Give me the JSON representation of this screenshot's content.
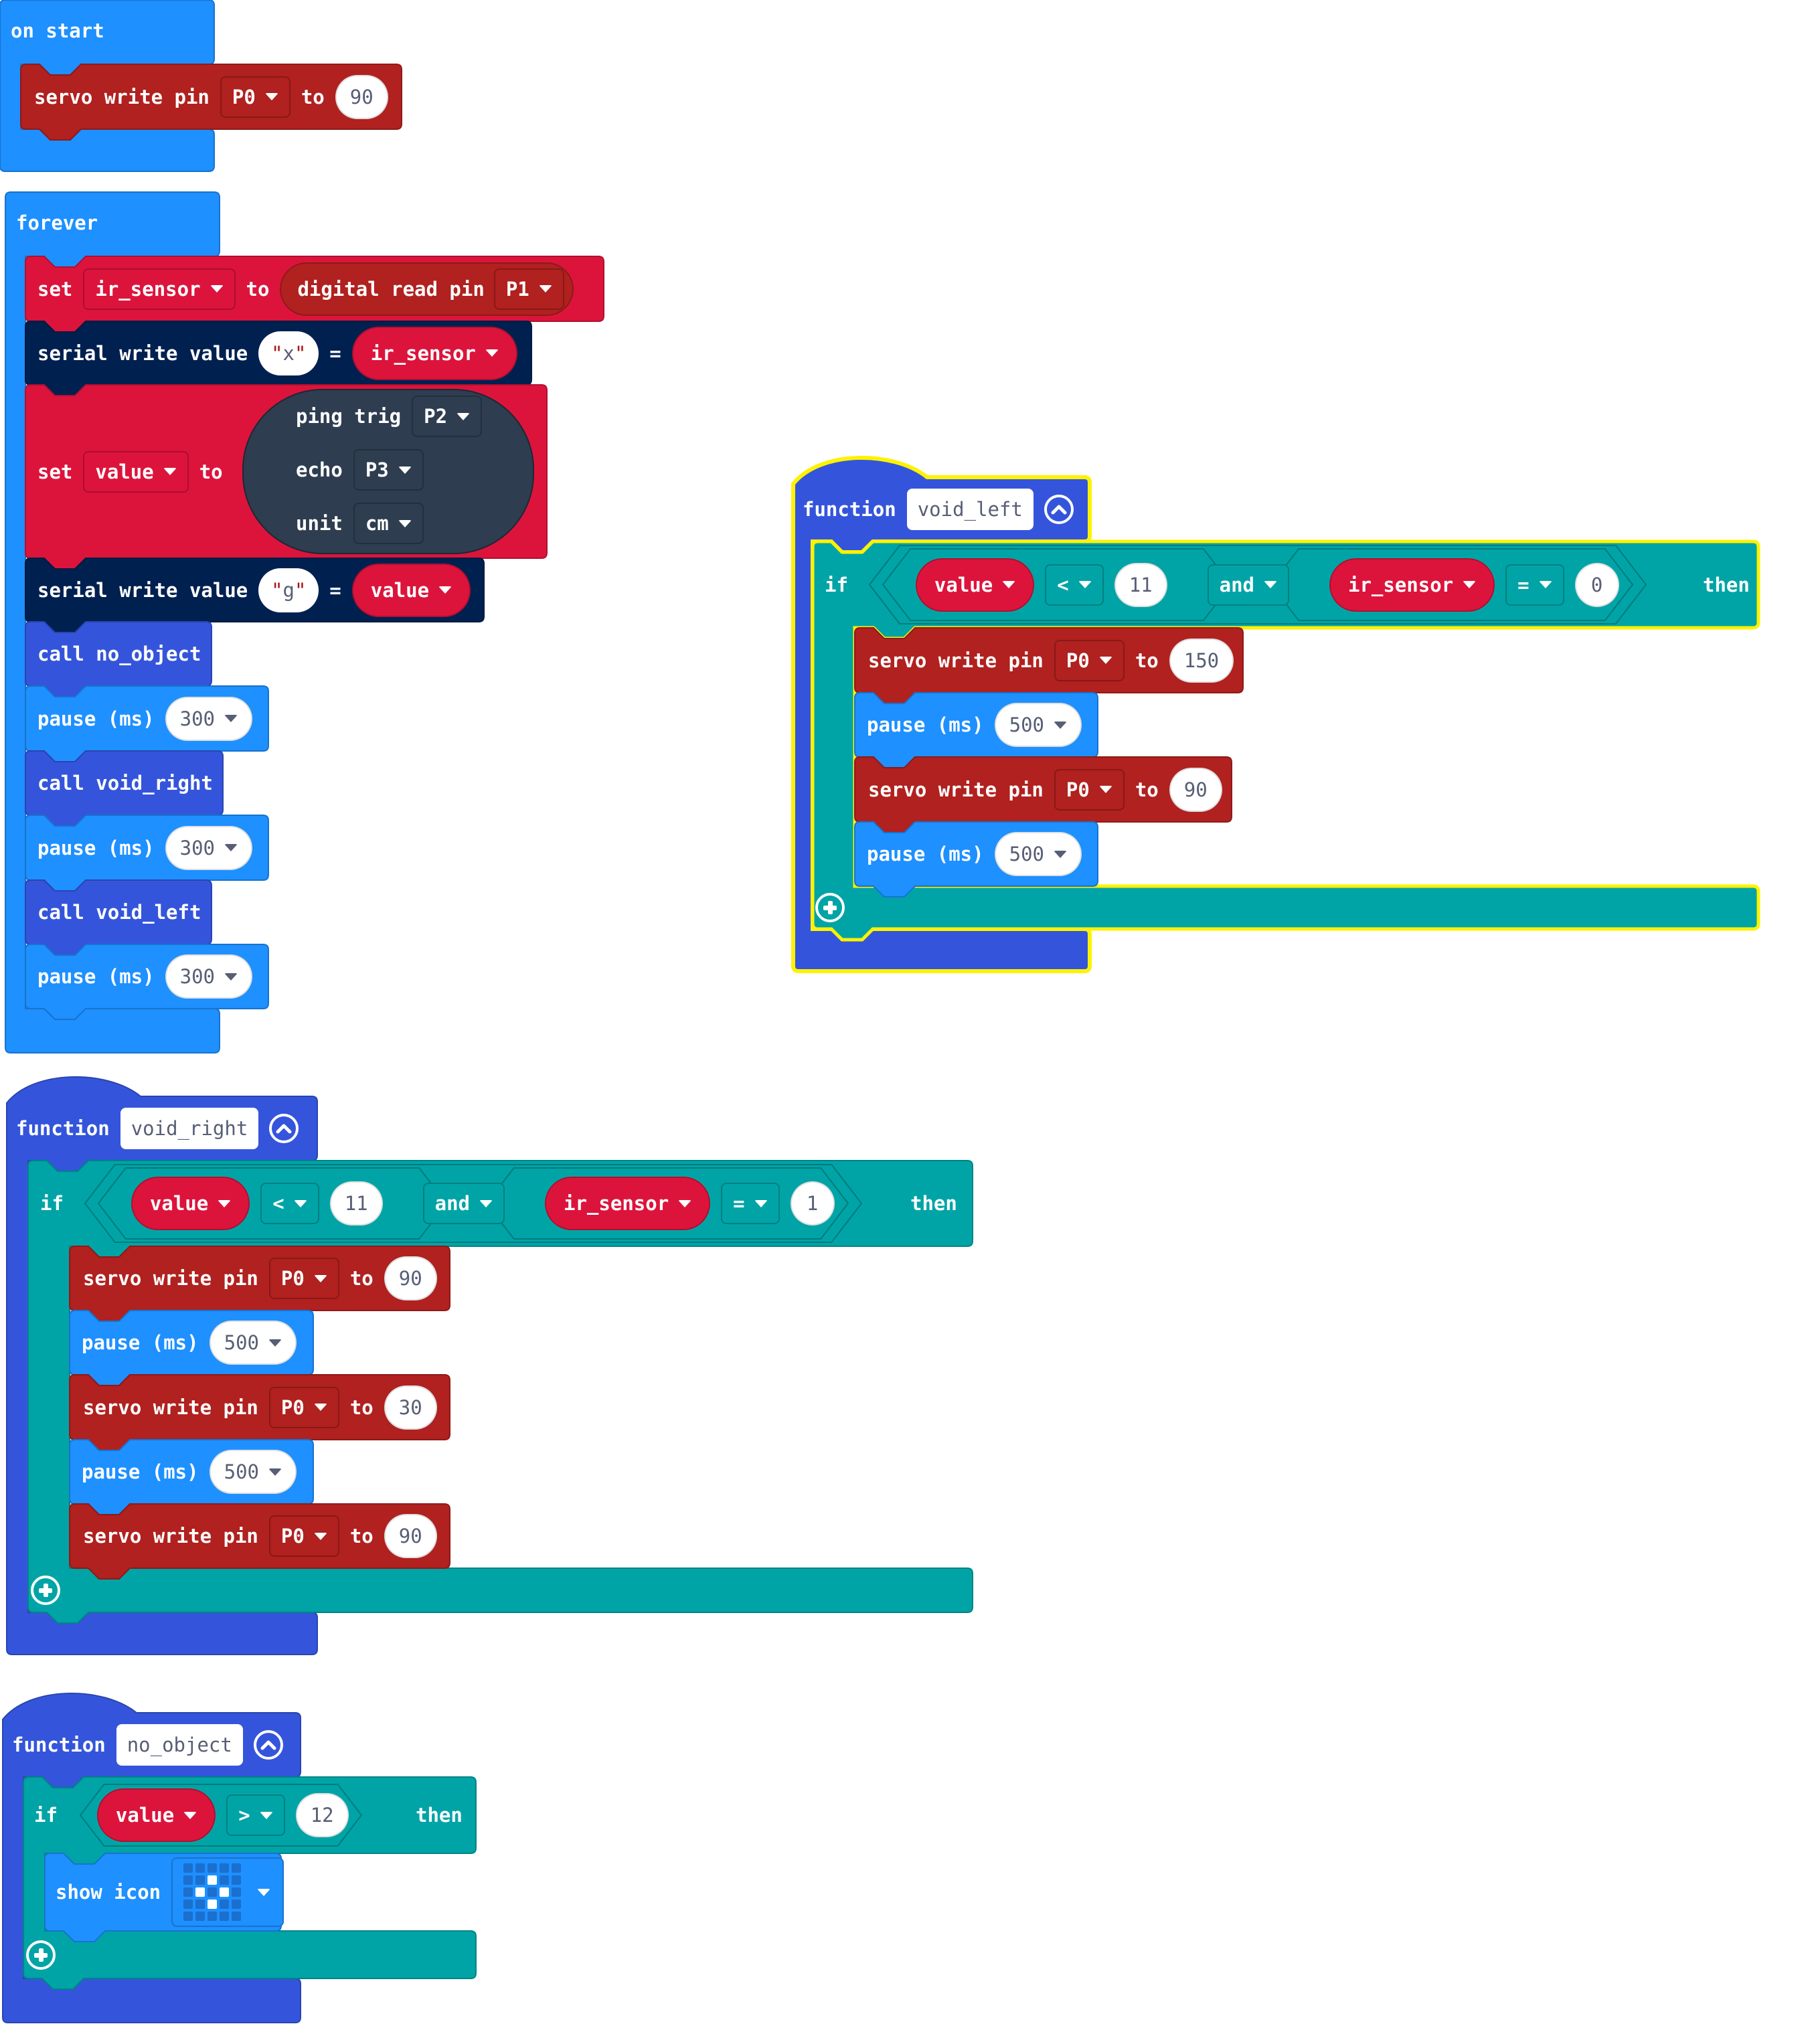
{
  "workspace": {
    "colors": {
      "basic": "#1E90FF",
      "servo": "#B0211F",
      "servo_pin_read": "#B0211F",
      "variable": "#DC143C",
      "serial": "#002050",
      "function": "#3455DB",
      "logic": "#00A4A6",
      "ping": "#2E3D50",
      "selected_outline": "#FFF200"
    },
    "on_start": {
      "label": "on start",
      "statements": [
        {
          "kind": "servo",
          "text": "servo write pin",
          "pin": "P0",
          "to": "to",
          "value": "90"
        }
      ]
    },
    "forever": {
      "label": "forever",
      "statements": [
        {
          "kind": "set",
          "set": "set",
          "var": "ir_sensor",
          "to": "to",
          "reporter": "digital read pin",
          "pin": "P1"
        },
        {
          "kind": "serial",
          "text": "serial write value",
          "name": "x",
          "eq": "=",
          "var": "ir_sensor"
        },
        {
          "kind": "set_ping",
          "set": "set",
          "var": "value",
          "to": "to",
          "ping": {
            "trig_label": "ping trig",
            "trig": "P2",
            "echo_label": "echo",
            "echo": "P3",
            "unit_label": "unit",
            "unit": "cm"
          }
        },
        {
          "kind": "serial",
          "text": "serial write value",
          "name": "g",
          "eq": "=",
          "var": "value"
        },
        {
          "kind": "call",
          "text": "call no_object"
        },
        {
          "kind": "pause",
          "text": "pause (ms)",
          "value": "300"
        },
        {
          "kind": "call",
          "text": "call void_right"
        },
        {
          "kind": "pause",
          "text": "pause (ms)",
          "value": "300"
        },
        {
          "kind": "call",
          "text": "call void_left"
        },
        {
          "kind": "pause",
          "text": "pause (ms)",
          "value": "300"
        }
      ]
    },
    "functions": [
      {
        "id": "void_left",
        "label": "function",
        "name": "void_left",
        "selected": true,
        "if": {
          "if_label": "if",
          "then_label": "then",
          "condition": {
            "left": {
              "var": "value",
              "op": "<",
              "num": "11"
            },
            "joiner": "and",
            "right": {
              "var": "ir_sensor",
              "op": "=",
              "num": "0"
            }
          },
          "statements": [
            {
              "kind": "servo",
              "text": "servo write pin",
              "pin": "P0",
              "to": "to",
              "value": "150"
            },
            {
              "kind": "pause",
              "text": "pause (ms)",
              "value": "500"
            },
            {
              "kind": "servo",
              "text": "servo write pin",
              "pin": "P0",
              "to": "to",
              "value": "90"
            },
            {
              "kind": "pause",
              "text": "pause (ms)",
              "value": "500"
            }
          ]
        }
      },
      {
        "id": "void_right",
        "label": "function",
        "name": "void_right",
        "selected": false,
        "if": {
          "if_label": "if",
          "then_label": "then",
          "condition": {
            "left": {
              "var": "value",
              "op": "<",
              "num": "11"
            },
            "joiner": "and",
            "right": {
              "var": "ir_sensor",
              "op": "=",
              "num": "1"
            }
          },
          "statements": [
            {
              "kind": "servo",
              "text": "servo write pin",
              "pin": "P0",
              "to": "to",
              "value": "90"
            },
            {
              "kind": "pause",
              "text": "pause (ms)",
              "value": "500"
            },
            {
              "kind": "servo",
              "text": "servo write pin",
              "pin": "P0",
              "to": "to",
              "value": "30"
            },
            {
              "kind": "pause",
              "text": "pause (ms)",
              "value": "500"
            },
            {
              "kind": "servo",
              "text": "servo write pin",
              "pin": "P0",
              "to": "to",
              "value": "90"
            }
          ]
        }
      },
      {
        "id": "no_object",
        "label": "function",
        "name": "no_object",
        "selected": false,
        "if": {
          "if_label": "if",
          "then_label": "then",
          "condition": {
            "single": {
              "var": "value",
              "op": ">",
              "num": "12"
            }
          },
          "statements": [
            {
              "kind": "show_icon",
              "text": "show icon",
              "icon": "small-diamond",
              "leds": [
                [
                  0,
                  0,
                  0,
                  0,
                  0
                ],
                [
                  0,
                  0,
                  1,
                  0,
                  0
                ],
                [
                  0,
                  1,
                  0,
                  1,
                  0
                ],
                [
                  0,
                  0,
                  1,
                  0,
                  0
                ],
                [
                  0,
                  0,
                  0,
                  0,
                  0
                ]
              ]
            }
          ]
        }
      }
    ]
  }
}
